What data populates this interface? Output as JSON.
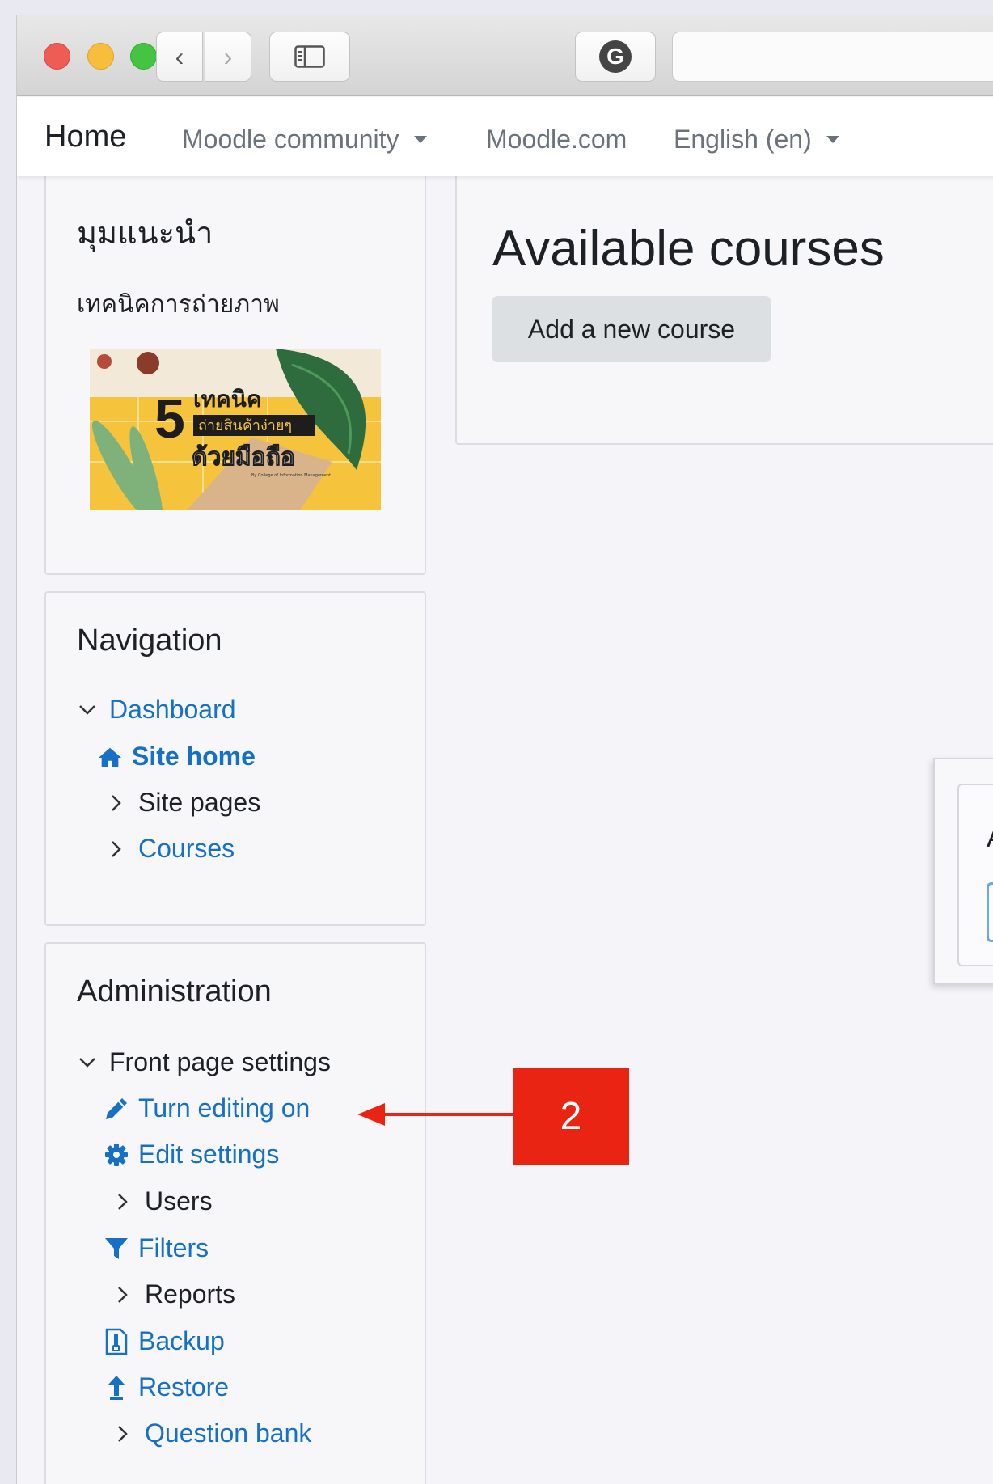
{
  "browser": {
    "back_icon": "‹",
    "forward_icon": "›",
    "sidebar_icon": "sidebar-icon",
    "grammarly_icon": "G"
  },
  "topnav": {
    "home": "Home",
    "items": [
      {
        "label": "Moodle community",
        "dropdown": true
      },
      {
        "label": "Moodle.com",
        "dropdown": false
      },
      {
        "label": "English (en)",
        "dropdown": true
      }
    ]
  },
  "tip_block": {
    "title": "มุมแนะนำ",
    "subtitle": "เทคนิคการถ่ายภาพ",
    "image": {
      "big_number": "5",
      "line1": "เทคนิค",
      "line2": "ถ่ายสินค้าง่ายๆ",
      "line3": "ด้วยมือถือ",
      "credit": "By College of Information Management"
    }
  },
  "navigation": {
    "title": "Navigation",
    "items": [
      {
        "label": "Dashboard",
        "icon": "chevron-down-icon"
      },
      {
        "label": "Site home",
        "icon": "home-icon"
      },
      {
        "label": "Site pages",
        "icon": "chevron-right-icon"
      },
      {
        "label": "Courses",
        "icon": "chevron-right-icon"
      }
    ]
  },
  "administration": {
    "title": "Administration",
    "items": [
      {
        "label": "Front page settings",
        "icon": "chevron-down-icon"
      },
      {
        "label": "Turn editing on",
        "icon": "pencil-icon"
      },
      {
        "label": "Edit settings",
        "icon": "gear-icon"
      },
      {
        "label": "Users",
        "icon": "chevron-right-icon"
      },
      {
        "label": "Filters",
        "icon": "filter-icon"
      },
      {
        "label": "Reports",
        "icon": "chevron-right-icon"
      },
      {
        "label": "Backup",
        "icon": "backup-file-icon"
      },
      {
        "label": "Restore",
        "icon": "restore-upload-icon"
      },
      {
        "label": "Question bank",
        "icon": "chevron-right-icon"
      }
    ]
  },
  "main": {
    "title": "Available courses",
    "add_button": "Add a new course"
  },
  "popup": {
    "letter": "A"
  },
  "annotation": {
    "number": "2",
    "color": "#ea2412"
  },
  "colors": {
    "link": "#1670c6",
    "text": "#1d2125",
    "muted": "#6a737b"
  }
}
